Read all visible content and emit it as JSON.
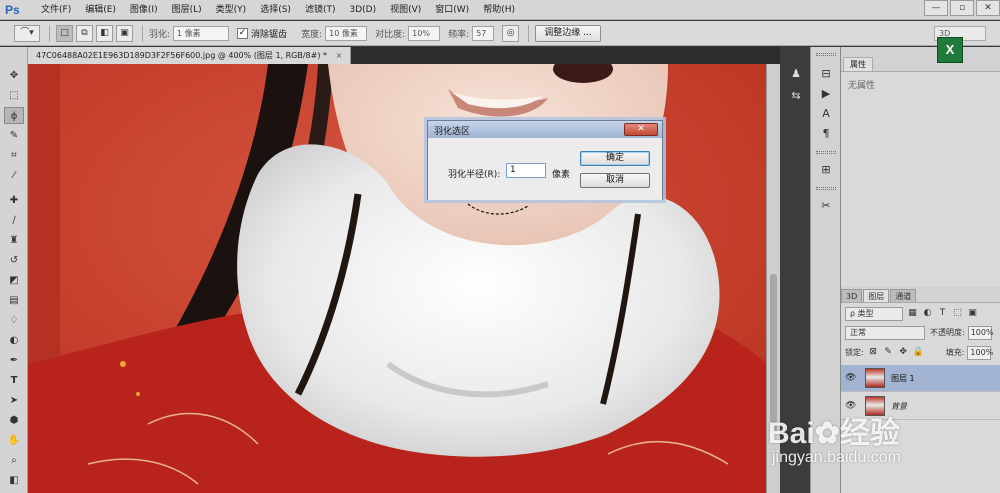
{
  "app": {
    "logo": "Ps",
    "menu": [
      "文件(F)",
      "编辑(E)",
      "图像(I)",
      "图层(L)",
      "类型(Y)",
      "选择(S)",
      "滤镜(T)",
      "3D(D)",
      "视图(V)",
      "窗口(W)",
      "帮助(H)"
    ],
    "window_controls": [
      "—",
      "▫",
      "✕"
    ]
  },
  "options_bar": {
    "feather_label": "羽化:",
    "feather_value": "1 像素",
    "antialias_label": "消除锯齿",
    "width_label": "宽度:",
    "width_value": "10 像素",
    "contrast_label": "对比度:",
    "contrast_value": "10%",
    "frequency_label": "频率:",
    "frequency_value": "57",
    "refine_edge_button": "调整边缘 ...",
    "workspace_value": "3D"
  },
  "document": {
    "tab_title": "47C06488A02E1E963D189D3F2F56F600.jpg @ 400% (图层 1, RGB/8#) *",
    "tab_close": "×"
  },
  "dialog": {
    "title": "羽化选区",
    "feather_radius_label": "羽化半径(R):",
    "feather_radius_value": "1",
    "unit": "像素",
    "ok_button": "确定",
    "cancel_button": "取消",
    "close_glyph": "✕"
  },
  "properties_panel": {
    "tab": "属性",
    "empty_text": "无属性"
  },
  "layers_panel": {
    "tabs": [
      "3D",
      "图层",
      "通道"
    ],
    "active_tab": "图层",
    "filter_kind": "ρ 类型",
    "blend_mode": "正常",
    "opacity_label": "不透明度:",
    "opacity_value": "100%",
    "lock_label": "锁定:",
    "fill_label": "填充:",
    "fill_value": "100%",
    "layers": [
      {
        "name": "图层 1",
        "selected": true
      },
      {
        "name": "背景",
        "selected": false
      }
    ]
  },
  "watermark": {
    "brand": "Bai",
    "brand_tail": "经验",
    "url": "jingyan.baidu.com"
  },
  "colors": {
    "canvas_red": "#c43a2a",
    "selected_layer": "#a3b3d2",
    "dialog_title": "#9fb4d4",
    "ps_blue": "#2a64b4"
  }
}
